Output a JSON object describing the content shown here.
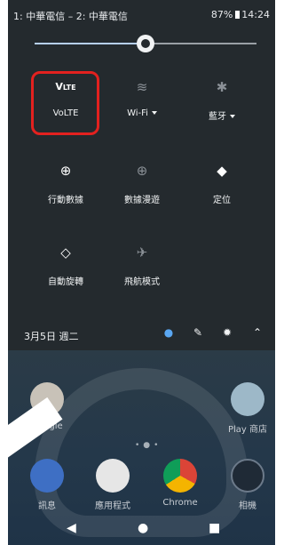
{
  "status": {
    "carriers": "1: 中華電信 – 2: 中華電信",
    "battery": "87%",
    "time": "14:24"
  },
  "brightness": {
    "level": 0.5
  },
  "tiles": [
    {
      "label": "VoLTE",
      "icon": "volte-icon",
      "glyph": "V",
      "on": true,
      "caret": false
    },
    {
      "label": "Wi-Fi",
      "icon": "wifi-off-icon",
      "glyph": "≋",
      "on": false,
      "caret": true
    },
    {
      "label": "藍牙",
      "icon": "bluetooth-off-icon",
      "glyph": "✱",
      "on": false,
      "caret": true
    },
    {
      "label": "行動數據",
      "icon": "globe-icon",
      "glyph": "⊕",
      "on": true,
      "caret": false
    },
    {
      "label": "數據漫遊",
      "icon": "roaming-icon",
      "glyph": "⊕",
      "on": false,
      "caret": false
    },
    {
      "label": "定位",
      "icon": "location-off-icon",
      "glyph": "◆",
      "on": true,
      "caret": false
    },
    {
      "label": "自動旋轉",
      "icon": "auto-rotate-icon",
      "glyph": "◇",
      "on": true,
      "caret": false
    },
    {
      "label": "飛航模式",
      "icon": "airplane-icon",
      "glyph": "✈",
      "on": false,
      "caret": false
    }
  ],
  "footer": {
    "date": "3月5日 週二"
  },
  "apps": [
    {
      "label": "Google",
      "color": "#c8c2b8"
    },
    {
      "label": "Play 商店",
      "color": "#9db8c8"
    },
    {
      "label": "訊息",
      "color": "#3e6fc4"
    },
    {
      "label": "應用程式",
      "color": "#e6e6e6"
    },
    {
      "label": "Chrome",
      "color": "#4d8fd6"
    },
    {
      "label": "相機",
      "color": "#1f2a36"
    }
  ],
  "colors": {
    "highlight": "#e3211f",
    "panel": "#242a2e"
  }
}
